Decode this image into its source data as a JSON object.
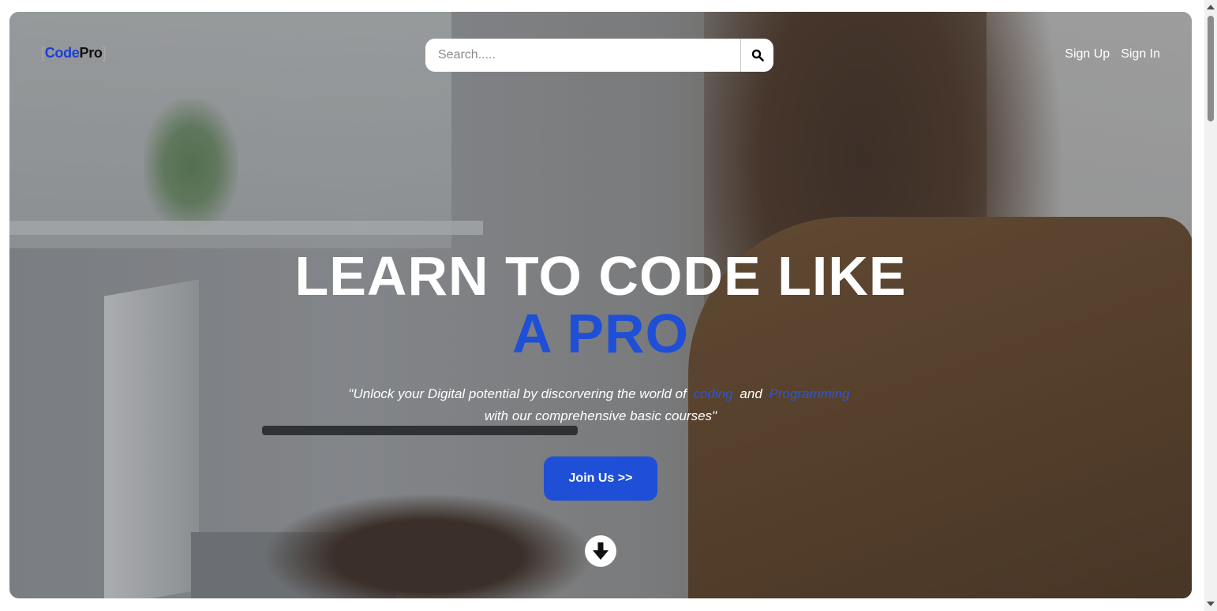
{
  "brand": {
    "open_bracket": "[",
    "code": "Code",
    "pro": "Pro",
    "close_bracket": "]",
    "accent": "#1f4fd6"
  },
  "search": {
    "placeholder": "Search.....",
    "value": "",
    "button_icon": "search-icon"
  },
  "nav": {
    "sign_up": "Sign Up",
    "sign_in": "Sign In"
  },
  "hero": {
    "line1": "LEARN TO CODE LIKE",
    "line2": "A PRO",
    "tagline": {
      "part1": "\"Unlock your Digital potential by discorvering the world of",
      "highlight1": "coding",
      "and": "and",
      "highlight2": "Programming",
      "part2": "with our comprehensive basic courses\""
    },
    "cta": "Join Us >>",
    "scroll_icon": "arrow-down-circle-icon"
  }
}
